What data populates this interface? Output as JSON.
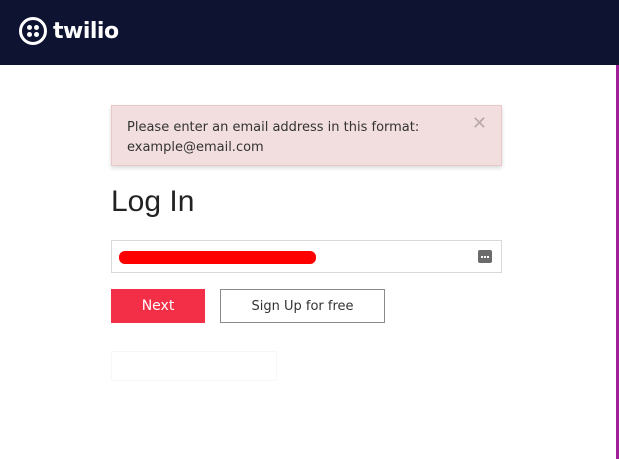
{
  "brand": {
    "name": "twilio",
    "header_bg": "#0d1330",
    "accent": "#f22f46",
    "stripe": "#a21f9a"
  },
  "alert": {
    "message": "Please enter an email address in this format: example@email.com",
    "close_symbol": "✕",
    "bg": "#f2dede"
  },
  "form": {
    "title": "Log In",
    "email_value": "",
    "next_label": "Next",
    "signup_label": "Sign Up for free"
  }
}
